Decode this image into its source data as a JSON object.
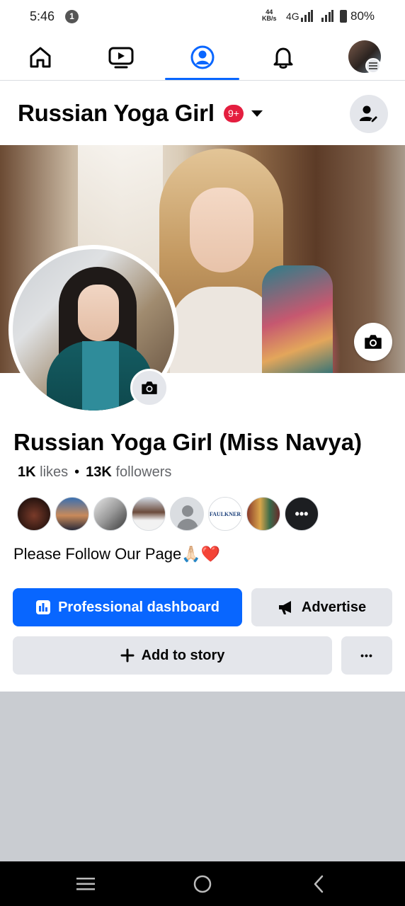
{
  "status_bar": {
    "time": "5:46",
    "notification_count": "1",
    "net_speed_value": "44",
    "net_speed_unit": "KB/s",
    "network_type": "4G",
    "battery": "80%"
  },
  "nav": {
    "items": [
      {
        "name": "home-icon"
      },
      {
        "name": "video-icon"
      },
      {
        "name": "profile-icon",
        "active": true
      },
      {
        "name": "bell-icon"
      },
      {
        "name": "avatar"
      }
    ],
    "accent_color": "#0866ff"
  },
  "page_header": {
    "title": "Russian Yoga Girl",
    "notification_badge": "9+"
  },
  "profile": {
    "name": "Russian Yoga Girl (Miss Navya)",
    "likes_count": "1K",
    "likes_label": "likes",
    "separator": "•",
    "followers_count": "13K",
    "followers_label": "followers",
    "bio": "Please Follow Our Page🙏🏻❤️",
    "follower_avatars": [
      {
        "kind": "photo"
      },
      {
        "kind": "photo"
      },
      {
        "kind": "photo"
      },
      {
        "kind": "photo"
      },
      {
        "kind": "default"
      },
      {
        "kind": "logo",
        "text": "FAULKNER"
      },
      {
        "kind": "photo"
      },
      {
        "kind": "more",
        "text": "•••"
      }
    ]
  },
  "actions": {
    "professional_dashboard": "Professional dashboard",
    "advertise": "Advertise",
    "add_to_story": "Add to story",
    "more": "•••"
  }
}
